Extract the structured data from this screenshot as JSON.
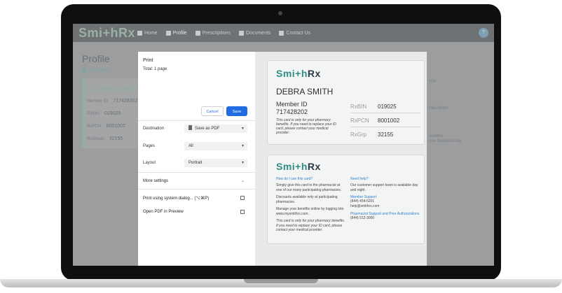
{
  "nav": {
    "logo": "Smi+hRx",
    "items": [
      {
        "label": "Home",
        "icon": "home-icon"
      },
      {
        "label": "Profile",
        "icon": "profile-icon"
      },
      {
        "label": "Prescriptions",
        "icon": "prescriptions-icon"
      },
      {
        "label": "Documents",
        "icon": "documents-icon"
      },
      {
        "label": "Contact Us",
        "icon": "contact-icon"
      }
    ],
    "avatar": "?"
  },
  "background": {
    "title": "Profile",
    "account": "Account",
    "greeting": "Hi, Debra Smith!",
    "rows": [
      {
        "label": "Member ID:",
        "value": "717428202"
      },
      {
        "label": "RxBIN:",
        "value": "019025"
      },
      {
        "label": "RxPCN:",
        "value": "8001002"
      },
      {
        "label": "RxGroup:",
        "value": "32155"
      }
    ],
    "right_texts": [
      "you.",
      "Mail Order",
      "Smithrx",
      "one business day."
    ]
  },
  "print": {
    "title": "Print",
    "total": "Total: 1 page",
    "cancel_label": "Cancel",
    "save_label": "Save",
    "destination_label": "Destination",
    "destination_value": "Save as PDF",
    "pages_label": "Pages",
    "pages_value": "All",
    "layout_label": "Layout",
    "layout_value": "Portrait",
    "more_settings": "More settings",
    "system_dialog": "Print using system dialog... (⌥⌘P)",
    "open_pdf": "Open PDF in Preview"
  },
  "card_front": {
    "logo": "Smi+h",
    "logo_rx": "Rx",
    "name": "DEBRA SMITH",
    "member_id_label": "Member ID",
    "member_id": "717428202",
    "note": "This card is only for your pharmacy benefits. If you need to replace your ID card, please contact your medical provider.",
    "fields": [
      {
        "key": "RxBIN",
        "value": "019025"
      },
      {
        "key": "RxPCN",
        "value": "8001002"
      },
      {
        "key": "RxGrp",
        "value": "32155"
      }
    ]
  },
  "card_back": {
    "logo": "Smi+h",
    "logo_rx": "Rx",
    "how_heading": "How do I use this card?",
    "how_1": "Simply give this card to the pharmacist at one of our many participating pharmacies.",
    "how_2": "Discounts available only at participating pharmacies.",
    "how_3": "Manage your benefits online by logging into www.mysmithrx.com.",
    "how_4": "This card is only for your pharmacy benefits. If you need to replace your ID card, please contact your medical provider.",
    "help_heading": "Need help?",
    "help_1": "Our customer support team is available day and night.",
    "member_support_heading": "Member Support",
    "member_support": "(844) 454-5201\nhelp@smithrx.com",
    "pharmacy_heading": "Pharmacist Support and Prior Authorizations",
    "pharmacy_phone": "(844) 512-3000"
  }
}
